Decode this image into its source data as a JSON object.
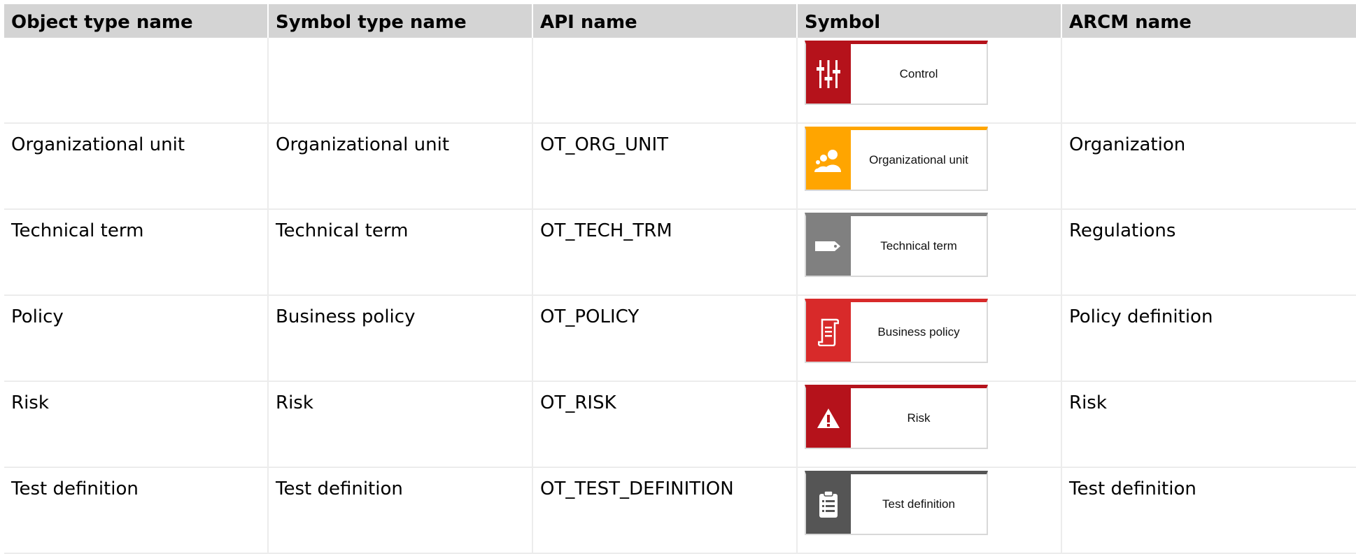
{
  "headers": [
    "Object type name",
    "Symbol type name",
    "API name",
    "Symbol",
    "ARCM name"
  ],
  "rows": [
    {
      "object_type": "",
      "symbol_type": "",
      "api_name": "",
      "symbol_label": "Control",
      "symbol_color": "#b5121b",
      "symbol_icon": "sliders-icon",
      "arcm_name": ""
    },
    {
      "object_type": "Organizational unit",
      "symbol_type": "Organizational unit",
      "api_name": "OT_ORG_UNIT",
      "symbol_label": "Organizational unit",
      "symbol_color": "#ffa500",
      "symbol_icon": "people-icon",
      "arcm_name": "Organization"
    },
    {
      "object_type": "Technical term",
      "symbol_type": "Technical term",
      "api_name": "OT_TECH_TRM",
      "symbol_label": "Technical term",
      "symbol_color": "#808080",
      "symbol_icon": "tag-icon",
      "arcm_name": "Regulations"
    },
    {
      "object_type": "Policy",
      "symbol_type": "Business policy",
      "api_name": "OT_POLICY",
      "symbol_label": "Business policy",
      "symbol_color": "#d82a2a",
      "symbol_icon": "scroll-icon",
      "arcm_name": "Policy definition"
    },
    {
      "object_type": "Risk",
      "symbol_type": "Risk",
      "api_name": "OT_RISK",
      "symbol_label": "Risk",
      "symbol_color": "#b5121b",
      "symbol_icon": "warning-icon",
      "arcm_name": "Risk"
    },
    {
      "object_type": "Test definition",
      "symbol_type": "Test definition",
      "api_name": "OT_TEST_DEFINITION",
      "symbol_label": "Test definition",
      "symbol_color": "#555555",
      "symbol_icon": "clipboard-icon",
      "arcm_name": "Test definition"
    }
  ]
}
